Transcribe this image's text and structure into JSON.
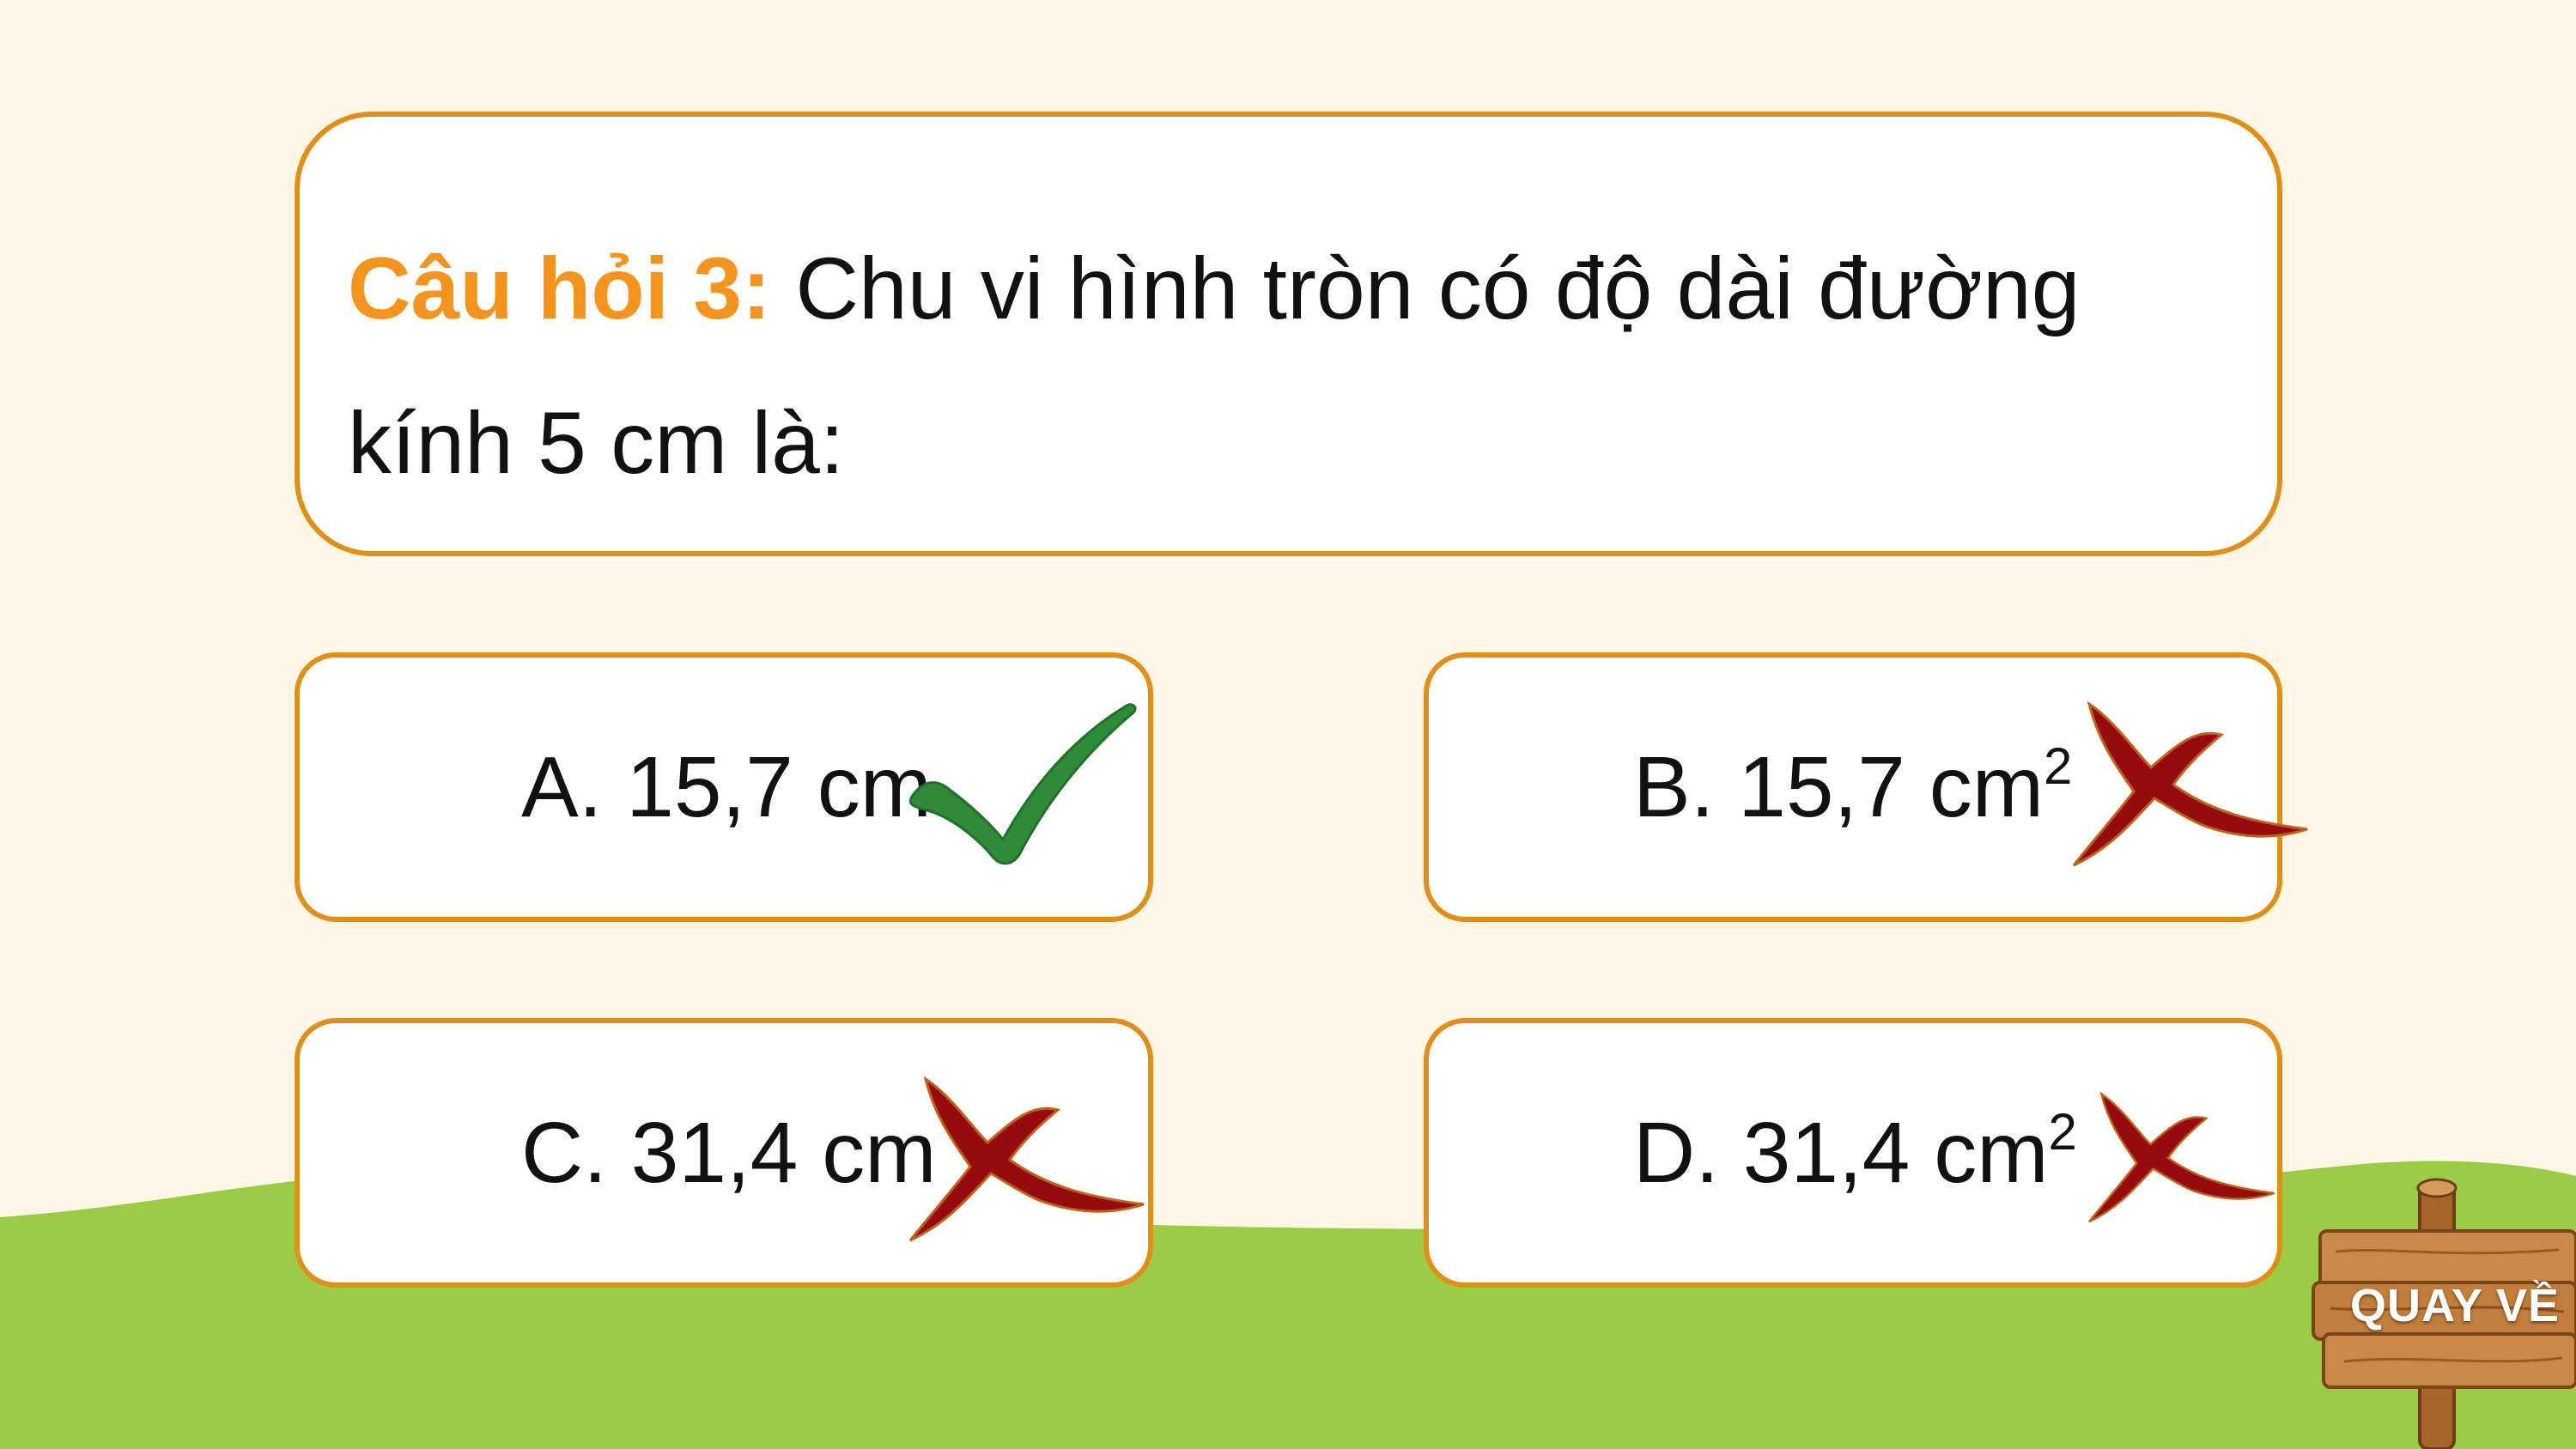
{
  "question": {
    "label": "Câu hỏi 3:",
    "text": " Chu vi hình tròn có độ dài đường kính 5 cm là:"
  },
  "answers": [
    {
      "letter": "A.",
      "value": "15,7 cm",
      "superscript": "",
      "mark": "check-icon",
      "correct": true
    },
    {
      "letter": "B.",
      "value": "15,7 cm",
      "superscript": "2",
      "mark": "x-icon",
      "correct": false
    },
    {
      "letter": "C.",
      "value": "31,4 cm",
      "superscript": "",
      "mark": "x-icon",
      "correct": false
    },
    {
      "letter": "D.",
      "value": "31,4 cm",
      "superscript": "2",
      "mark": "x-icon",
      "correct": false
    }
  ],
  "back_button": {
    "label": "QUAY VỀ",
    "icon": "wooden-sign-icon"
  },
  "colors": {
    "background": "#fdf6e4",
    "grass": "#9acd45",
    "accent_orange": "#e0901a",
    "label_orange": "#f4941e",
    "correct_green": "#2e8b37",
    "wrong_red": "#8b0a0a"
  }
}
